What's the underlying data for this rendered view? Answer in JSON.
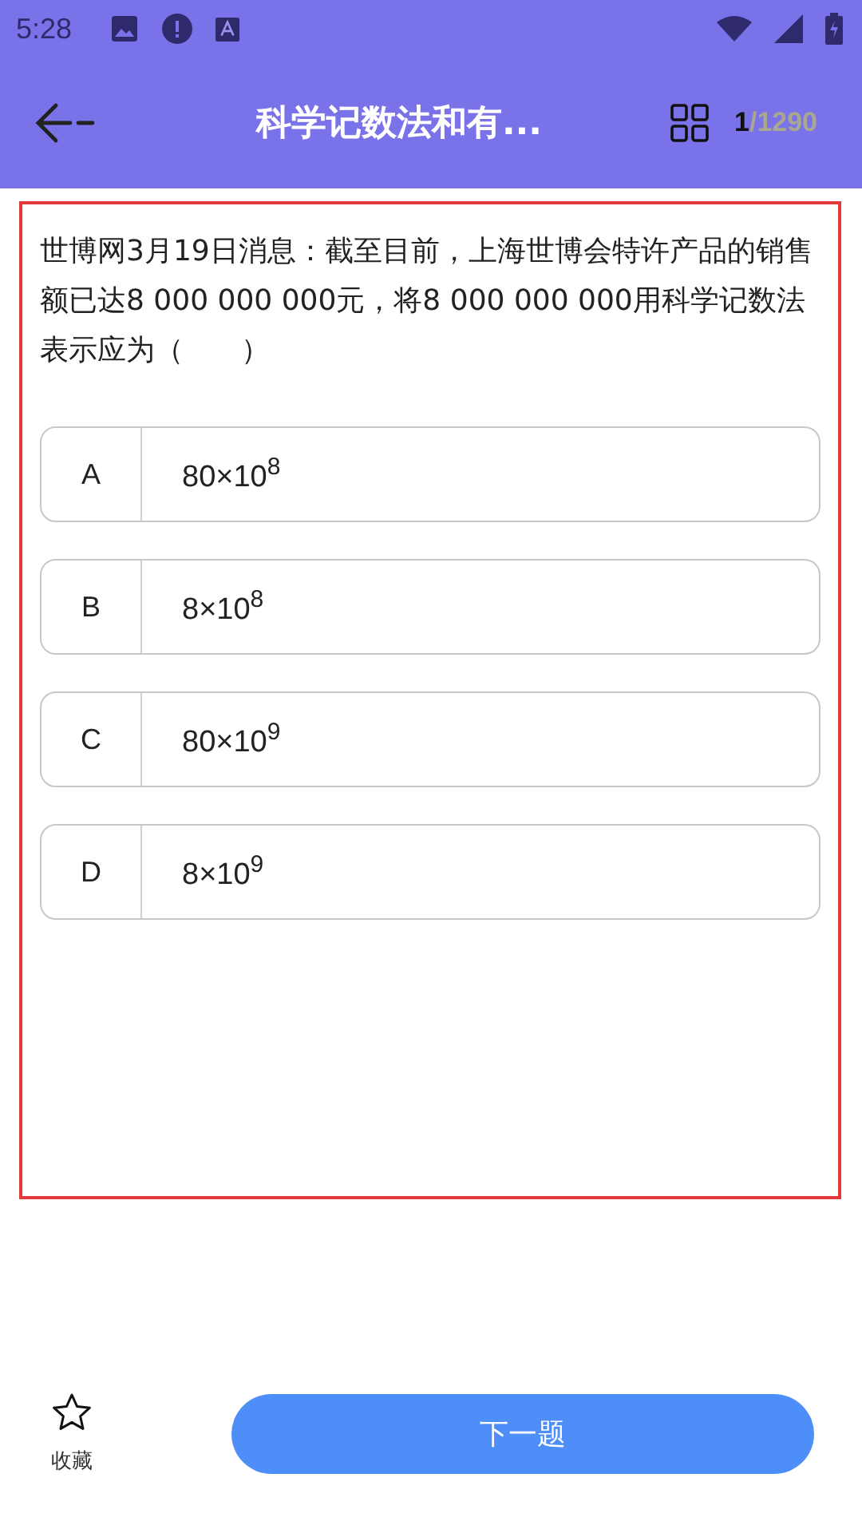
{
  "status_bar": {
    "time": "5:28"
  },
  "header": {
    "title": "科学记数法和有...",
    "counter": "**1**/1290"
  },
  "question": {
    "text": "世博网3月19日消息：截至目前，上海世博会特许产品的销售额已达8 000 000 000元，将8 000 000 000用科学记数法表示应为（　　）",
    "options": [
      {
        "label": "A",
        "text": "80×10$^{8}$"
      },
      {
        "label": "B",
        "text": "8×10$^{8}$"
      },
      {
        "label": "C",
        "text": "80×10$^{9}$"
      },
      {
        "label": "D",
        "text": "8×10$^{9}$"
      }
    ]
  },
  "footer": {
    "favorite_label": "收藏",
    "next_button": "下一题"
  }
}
